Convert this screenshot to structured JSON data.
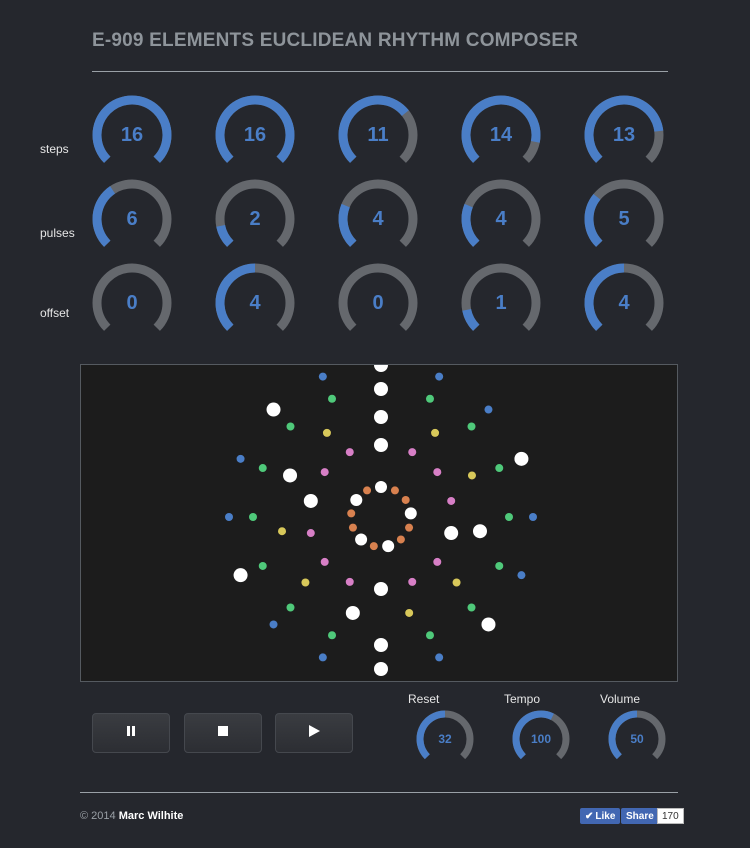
{
  "app": {
    "title": "E-909 ELEMENTS EUCLIDEAN RHYTHM COMPOSER"
  },
  "colors": {
    "accent": "#4a7ec7",
    "track": "#65686d",
    "background": "#25272d",
    "viz_bg": "#1c1c1c"
  },
  "rows": [
    {
      "label": "steps",
      "values": [
        16,
        16,
        11,
        14,
        13
      ],
      "fractions": [
        1.0,
        1.0,
        0.69,
        0.875,
        0.81
      ]
    },
    {
      "label": "pulses",
      "values": [
        6,
        2,
        4,
        4,
        5
      ],
      "fractions": [
        0.375,
        0.125,
        0.25,
        0.25,
        0.3125
      ]
    },
    {
      "label": "offset",
      "values": [
        0,
        4,
        0,
        1,
        4
      ],
      "fractions": [
        0.0,
        0.5,
        0.0,
        0.125,
        0.5
      ]
    }
  ],
  "visualizer": {
    "rings": [
      {
        "steps": 16,
        "pulses": 6,
        "color": "#4a7ec7",
        "active_color": "#ffffff"
      },
      {
        "steps": 16,
        "pulses": 2,
        "color": "#4fc97a",
        "active_color": "#ffffff"
      },
      {
        "steps": 11,
        "pulses": 4,
        "color": "#d8c85a",
        "active_color": "#ffffff"
      },
      {
        "steps": 14,
        "pulses": 4,
        "color": "#d77fc6",
        "active_color": "#ffffff"
      },
      {
        "steps": 13,
        "pulses": 5,
        "color": "#d8814f",
        "active_color": "#ffffff"
      }
    ]
  },
  "transport": {
    "pause_icon": "pause-icon",
    "stop_icon": "stop-icon",
    "play_icon": "play-icon"
  },
  "controls": [
    {
      "label": "Reset",
      "value": "32",
      "fraction": 0.5
    },
    {
      "label": "Tempo",
      "value": "100",
      "fraction": 0.6
    },
    {
      "label": "Volume",
      "value": "50",
      "fraction": 0.5
    }
  ],
  "footer": {
    "copyright_prefix": "© 2014",
    "author": "Marc Wilhite",
    "like_label": "Like",
    "share_label": "Share",
    "share_count": "170"
  }
}
